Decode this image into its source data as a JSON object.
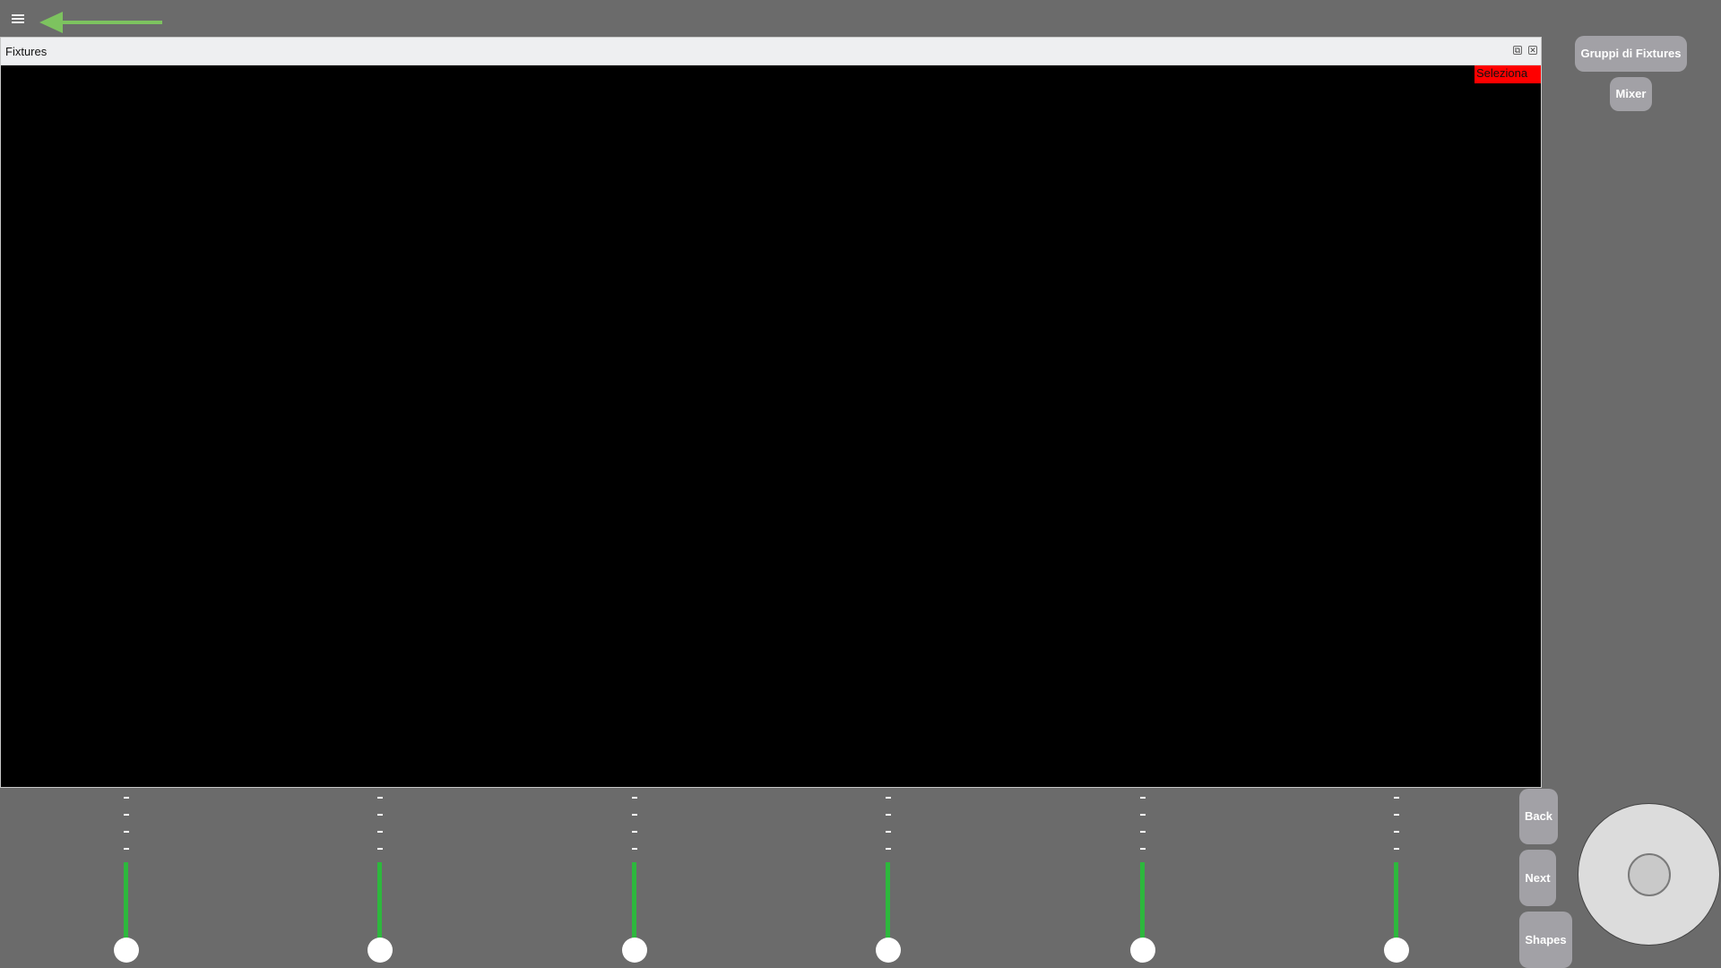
{
  "topbar": {
    "menu_icon": "hamburger-menu-icon",
    "arrow_icon": "left-arrow-icon",
    "arrow_color": "#7dc35f"
  },
  "window": {
    "title": "Fixtures",
    "restore_icon": "restore-window-icon",
    "close_icon": "close-window-icon",
    "restore_glyph": "⧉",
    "close_glyph": "✕",
    "select_button": "Seleziona",
    "select_color": "#ff0000"
  },
  "side_buttons": {
    "groups": "Gruppi di Fixtures",
    "mixer": "Mixer"
  },
  "sliders": [
    {
      "labels": [
        "-",
        "-",
        "-",
        "-"
      ],
      "value": 0
    },
    {
      "labels": [
        "-",
        "-",
        "-",
        "-"
      ],
      "value": 0
    },
    {
      "labels": [
        "-",
        "-",
        "-",
        "-"
      ],
      "value": 0
    },
    {
      "labels": [
        "-",
        "-",
        "-",
        "-"
      ],
      "value": 0
    },
    {
      "labels": [
        "-",
        "-",
        "-",
        "-"
      ],
      "value": 0
    },
    {
      "labels": [
        "-",
        "-",
        "-",
        "-"
      ],
      "value": 0
    }
  ],
  "slider_color": "#2db83d",
  "nav_buttons": {
    "back": "Back",
    "next": "Next",
    "shapes": "Shapes"
  },
  "joystick": {
    "x": 0,
    "y": 0
  }
}
